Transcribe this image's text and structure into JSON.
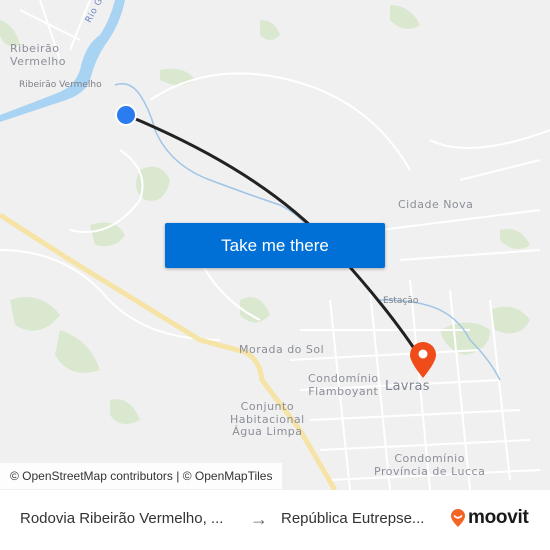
{
  "map": {
    "labels": {
      "ribeirao_vermelho_town": "Ribeirão\nVermelho",
      "ribeirao_vermelho_small": "Ribeirão Vermelho",
      "rio_grande": "Rio Grande",
      "cidade_nova": "Cidade Nova",
      "estacao": "Estação",
      "morada_do_sol": "Morada do Sol",
      "condominio_flamboyant": "Condomínio\nFlamboyant",
      "lavras": "Lavras",
      "conjunto_habitacional": "Conjunto\nHabitacional\nÁgua Limpa",
      "condominio_provincia": "Condomínio\nProvíncia de Lucca"
    },
    "origin_marker_color": "#2b7cf0",
    "destination_marker_color": "#ef4c1a",
    "route_color": "#222222"
  },
  "cta": {
    "label": "Take me there",
    "color": "#0070d6"
  },
  "attribution": "© OpenStreetMap contributors | © OpenMapTiles",
  "footer": {
    "origin": "Rodovia Ribeirão Vermelho, ...",
    "arrow": "→",
    "destination": "República Eutrepse...",
    "brand": "moovit",
    "brand_color": "#f26522"
  }
}
